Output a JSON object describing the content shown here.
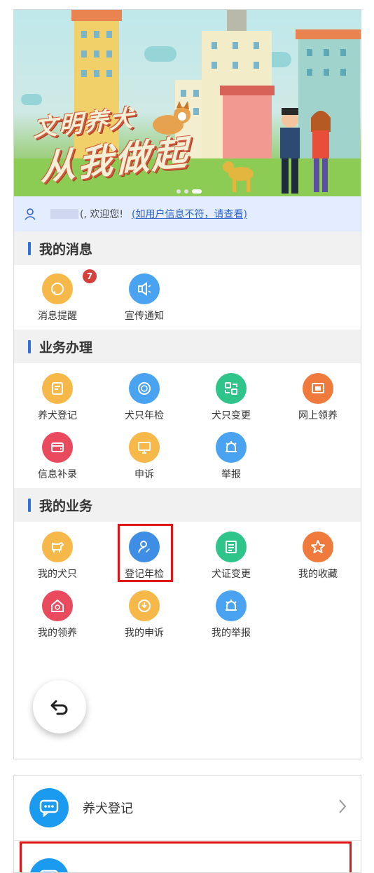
{
  "banner": {
    "slogan_line1": "文明养犬",
    "slogan_line2": "从我做起"
  },
  "user": {
    "greeting": "(, 欢迎您!",
    "link": "(如用户信息不符，请查看)"
  },
  "sections": {
    "messages": {
      "title": "我的消息",
      "items": [
        {
          "label": "消息提醒",
          "color": "#f7b84a",
          "badge": "7"
        },
        {
          "label": "宣传通知",
          "color": "#4aa3f0"
        }
      ]
    },
    "business": {
      "title": "业务办理",
      "items": [
        {
          "label": "养犬登记",
          "color": "#f7b84a"
        },
        {
          "label": "犬只年检",
          "color": "#4aa3f0"
        },
        {
          "label": "犬只变更",
          "color": "#2ec48a"
        },
        {
          "label": "网上领养",
          "color": "#f07a3c"
        },
        {
          "label": "信息补录",
          "color": "#ea4a5e"
        },
        {
          "label": "申诉",
          "color": "#f7b84a"
        },
        {
          "label": "举报",
          "color": "#4aa3f0"
        }
      ]
    },
    "mine": {
      "title": "我的业务",
      "items": [
        {
          "label": "我的犬只",
          "color": "#f7b84a"
        },
        {
          "label": "登记年检",
          "color": "#3e8ee6"
        },
        {
          "label": "犬证变更",
          "color": "#2ec48a"
        },
        {
          "label": "我的收藏",
          "color": "#f07a3c"
        },
        {
          "label": "我的领养",
          "color": "#ea4a5e"
        },
        {
          "label": "我的申诉",
          "color": "#f7b84a"
        },
        {
          "label": "我的举报",
          "color": "#4aa3f0"
        }
      ]
    }
  },
  "bottom": {
    "row1_label": "养犬登记",
    "row2_label": ""
  },
  "colors": {
    "accent": "#2f6fe0",
    "highlight": "#e01515"
  }
}
